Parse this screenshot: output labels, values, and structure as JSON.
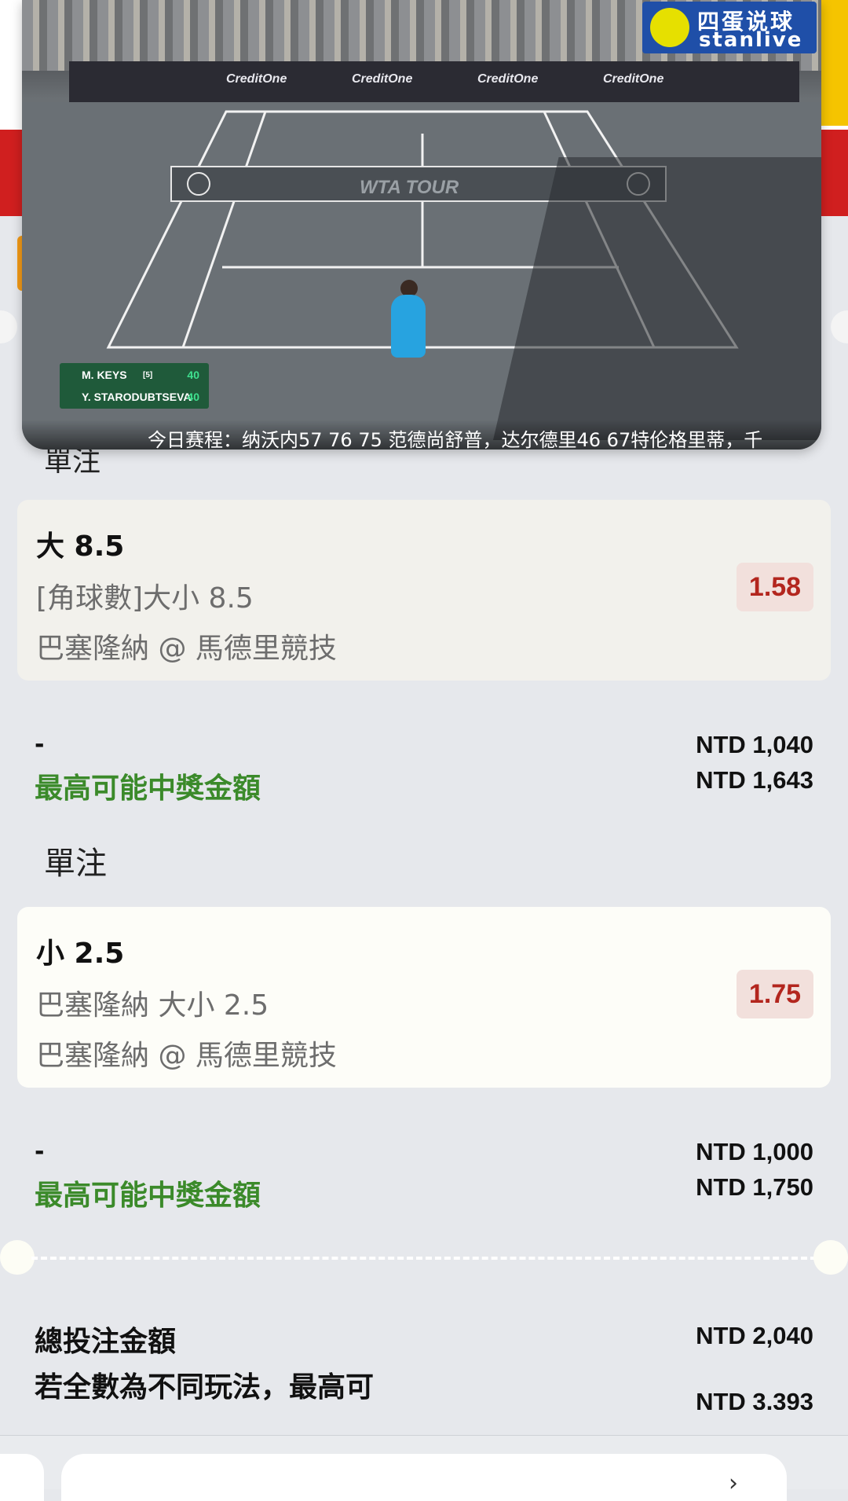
{
  "video": {
    "logo_cn": "四蛋说球",
    "logo_en": "stanlive",
    "board_texts": [
      "CreditOne",
      "CreditOne",
      "CreditOne",
      "CreditOne"
    ],
    "court_text": "WTA TOUR",
    "score": [
      {
        "name": "M. KEYS",
        "seed": "[5]",
        "points": "40"
      },
      {
        "name": "Y. STARODUBTSEVA",
        "seed": "",
        "points": "40"
      }
    ],
    "ticker": "今日赛程：纳沃内57 76 75 范德尚舒普，达尔德里46 67特伦格里蒂，千"
  },
  "peek_label": "單注",
  "bets": [
    {
      "selection": "大 8.5",
      "market": "[角球數]大小 8.5",
      "event": "巴塞隆納 @ 馬德里競技",
      "odds": "1.58",
      "stake_label": "-",
      "stake": "NTD 1,040",
      "win_label": "最高可能中獎金額",
      "win": "NTD 1,643"
    },
    {
      "section_label": "單注",
      "selection": "小 2.5",
      "market": "巴塞隆納 大小 2.5",
      "event": "巴塞隆納 @ 馬德里競技",
      "odds": "1.75",
      "stake_label": "-",
      "stake": "NTD 1,000",
      "win_label": "最高可能中獎金額",
      "win": "NTD 1,750"
    }
  ],
  "summary": {
    "total_label": "總投注金額",
    "total": "NTD 2,040",
    "multi_label": "若全數為不同玩法，最高可",
    "multi": "NTD 3,393"
  },
  "bottom": {
    "chevron": "›"
  },
  "colors": {
    "odds_text": "#b3261e",
    "win_text": "#3b8a2a",
    "header_red": "#d01f1f"
  }
}
